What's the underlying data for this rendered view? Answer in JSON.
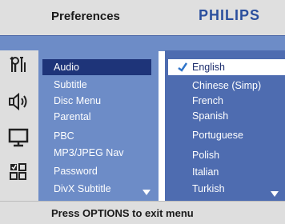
{
  "header": {
    "title": "Preferences",
    "brand": "PHILIPS"
  },
  "icons": [
    "settings-tools-icon",
    "speaker-audio-icon",
    "monitor-video-icon",
    "preferences-grid-icon"
  ],
  "menu": {
    "items": [
      {
        "label": "Audio",
        "selected": true
      },
      {
        "label": "Subtitle"
      },
      {
        "label": "Disc Menu"
      },
      {
        "label": "Parental"
      },
      {
        "label": "PBC"
      },
      {
        "label": "MP3/JPEG Nav"
      },
      {
        "label": "Password"
      },
      {
        "label": "DivX Subtitle"
      }
    ]
  },
  "options": {
    "items": [
      {
        "label": "English",
        "selected": true
      },
      {
        "label": "Chinese (Simp)"
      },
      {
        "label": "French"
      },
      {
        "label": "Spanish"
      },
      {
        "label": "Portuguese"
      },
      {
        "label": "Polish"
      },
      {
        "label": "Italian"
      },
      {
        "label": "Turkish"
      }
    ]
  },
  "footer": {
    "hint": "Press OPTIONS to exit menu"
  },
  "colors": {
    "accent": "#1e3479",
    "panel": "#6d8cc7",
    "brand": "#2b4f9e"
  }
}
